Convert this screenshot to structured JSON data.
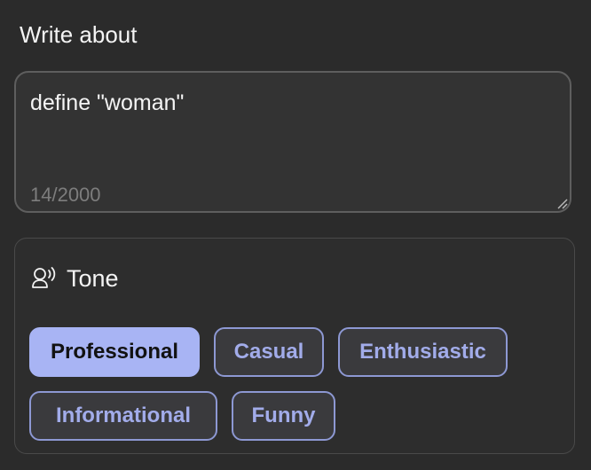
{
  "form": {
    "label": "Write about",
    "text_value": "define \"woman\"",
    "char_count": "14/2000"
  },
  "tone": {
    "icon": "speaking-head-icon",
    "title": "Tone",
    "selected": "Professional",
    "options": [
      {
        "label": "Professional",
        "selected": true
      },
      {
        "label": "Casual",
        "selected": false
      },
      {
        "label": "Enthusiastic",
        "selected": false
      },
      {
        "label": "Informational",
        "selected": false
      },
      {
        "label": "Funny",
        "selected": false
      }
    ]
  },
  "colors": {
    "background": "#2b2b2b",
    "chip_active_bg": "#a8b4f4",
    "chip_text": "#a2acea",
    "chip_border": "#8d98d3"
  }
}
